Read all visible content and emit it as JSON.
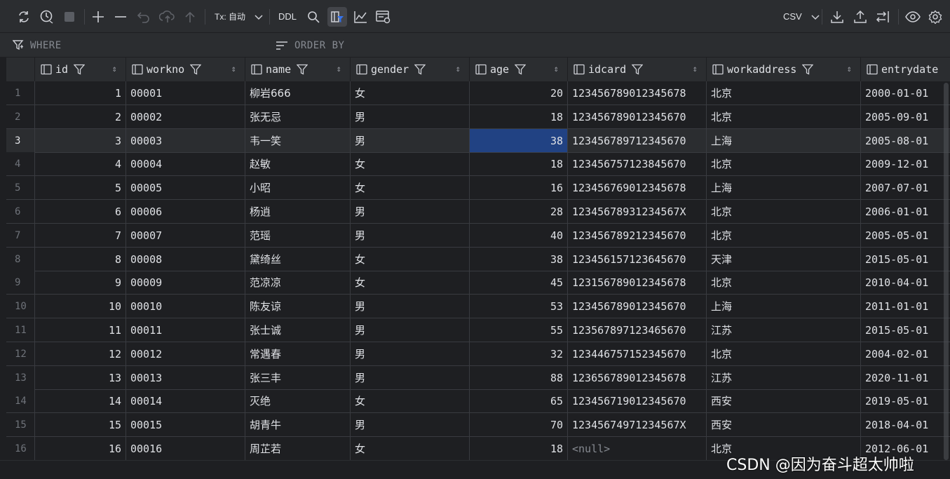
{
  "toolbar": {
    "tx_label": "Tx: 自动",
    "ddl_label": "DDL",
    "export_format": "CSV",
    "icons": [
      "refresh-icon",
      "history-icon",
      "stop-icon",
      "add-row-icon",
      "delete-row-icon",
      "undo-icon",
      "submit-icon",
      "upload-icon",
      "tx-dropdown",
      "ddl-button",
      "search-icon",
      "filter-toggle-icon",
      "chart-icon",
      "view-settings-icon",
      "download-icon",
      "export-icon",
      "compare-icon",
      "eye-icon",
      "settings-icon"
    ]
  },
  "filter": {
    "where_label": "WHERE",
    "order_label": "ORDER BY"
  },
  "columns": [
    "id",
    "workno",
    "name",
    "gender",
    "age",
    "idcard",
    "workaddress",
    "entrydate"
  ],
  "rows": [
    {
      "n": "1",
      "id": "1",
      "workno": "00001",
      "name": "柳岩666",
      "gender": "女",
      "age": "20",
      "idcard": "123456789012345678",
      "workaddress": "北京",
      "entrydate": "2000-01-01"
    },
    {
      "n": "2",
      "id": "2",
      "workno": "00002",
      "name": "张无忌",
      "gender": "男",
      "age": "18",
      "idcard": "123456789012345670",
      "workaddress": "北京",
      "entrydate": "2005-09-01"
    },
    {
      "n": "3",
      "id": "3",
      "workno": "00003",
      "name": "韦一笑",
      "gender": "男",
      "age": "38",
      "idcard": "123456789712345670",
      "workaddress": "上海",
      "entrydate": "2005-08-01"
    },
    {
      "n": "4",
      "id": "4",
      "workno": "00004",
      "name": "赵敏",
      "gender": "女",
      "age": "18",
      "idcard": "123456757123845670",
      "workaddress": "北京",
      "entrydate": "2009-12-01"
    },
    {
      "n": "5",
      "id": "5",
      "workno": "00005",
      "name": "小昭",
      "gender": "女",
      "age": "16",
      "idcard": "123456769012345678",
      "workaddress": "上海",
      "entrydate": "2007-07-01"
    },
    {
      "n": "6",
      "id": "6",
      "workno": "00006",
      "name": "杨逍",
      "gender": "男",
      "age": "28",
      "idcard": "12345678931234567X",
      "workaddress": "北京",
      "entrydate": "2006-01-01"
    },
    {
      "n": "7",
      "id": "7",
      "workno": "00007",
      "name": "范瑶",
      "gender": "男",
      "age": "40",
      "idcard": "123456789212345670",
      "workaddress": "北京",
      "entrydate": "2005-05-01"
    },
    {
      "n": "8",
      "id": "8",
      "workno": "00008",
      "name": "黛绮丝",
      "gender": "女",
      "age": "38",
      "idcard": "123456157123645670",
      "workaddress": "天津",
      "entrydate": "2015-05-01"
    },
    {
      "n": "9",
      "id": "9",
      "workno": "00009",
      "name": "范凉凉",
      "gender": "女",
      "age": "45",
      "idcard": "123156789012345678",
      "workaddress": "北京",
      "entrydate": "2010-04-01"
    },
    {
      "n": "10",
      "id": "10",
      "workno": "00010",
      "name": "陈友谅",
      "gender": "男",
      "age": "53",
      "idcard": "123456789012345670",
      "workaddress": "上海",
      "entrydate": "2011-01-01"
    },
    {
      "n": "11",
      "id": "11",
      "workno": "00011",
      "name": "张士诚",
      "gender": "男",
      "age": "55",
      "idcard": "123567897123465670",
      "workaddress": "江苏",
      "entrydate": "2015-05-01"
    },
    {
      "n": "12",
      "id": "12",
      "workno": "00012",
      "name": "常遇春",
      "gender": "男",
      "age": "32",
      "idcard": "123446757152345670",
      "workaddress": "北京",
      "entrydate": "2004-02-01"
    },
    {
      "n": "13",
      "id": "13",
      "workno": "00013",
      "name": "张三丰",
      "gender": "男",
      "age": "88",
      "idcard": "123656789012345678",
      "workaddress": "江苏",
      "entrydate": "2020-11-01"
    },
    {
      "n": "14",
      "id": "14",
      "workno": "00014",
      "name": "灭绝",
      "gender": "女",
      "age": "65",
      "idcard": "123456719012345670",
      "workaddress": "西安",
      "entrydate": "2019-05-01"
    },
    {
      "n": "15",
      "id": "15",
      "workno": "00015",
      "name": "胡青牛",
      "gender": "男",
      "age": "70",
      "idcard": "12345674971234567X",
      "workaddress": "西安",
      "entrydate": "2018-04-01"
    },
    {
      "n": "16",
      "id": "16",
      "workno": "00016",
      "name": "周芷若",
      "gender": "女",
      "age": "18",
      "idcard": "<null>",
      "workaddress": "北京",
      "entrydate": "2012-06-01"
    }
  ],
  "current_row": 3,
  "selected_cell": {
    "row": 3,
    "column": "age"
  },
  "watermark": "CSDN @因为奋斗超太帅啦",
  "colors": {
    "background": "#1e1f22",
    "toolbar": "#2b2d30",
    "selection": "#214283",
    "accent": "#3574f0"
  }
}
